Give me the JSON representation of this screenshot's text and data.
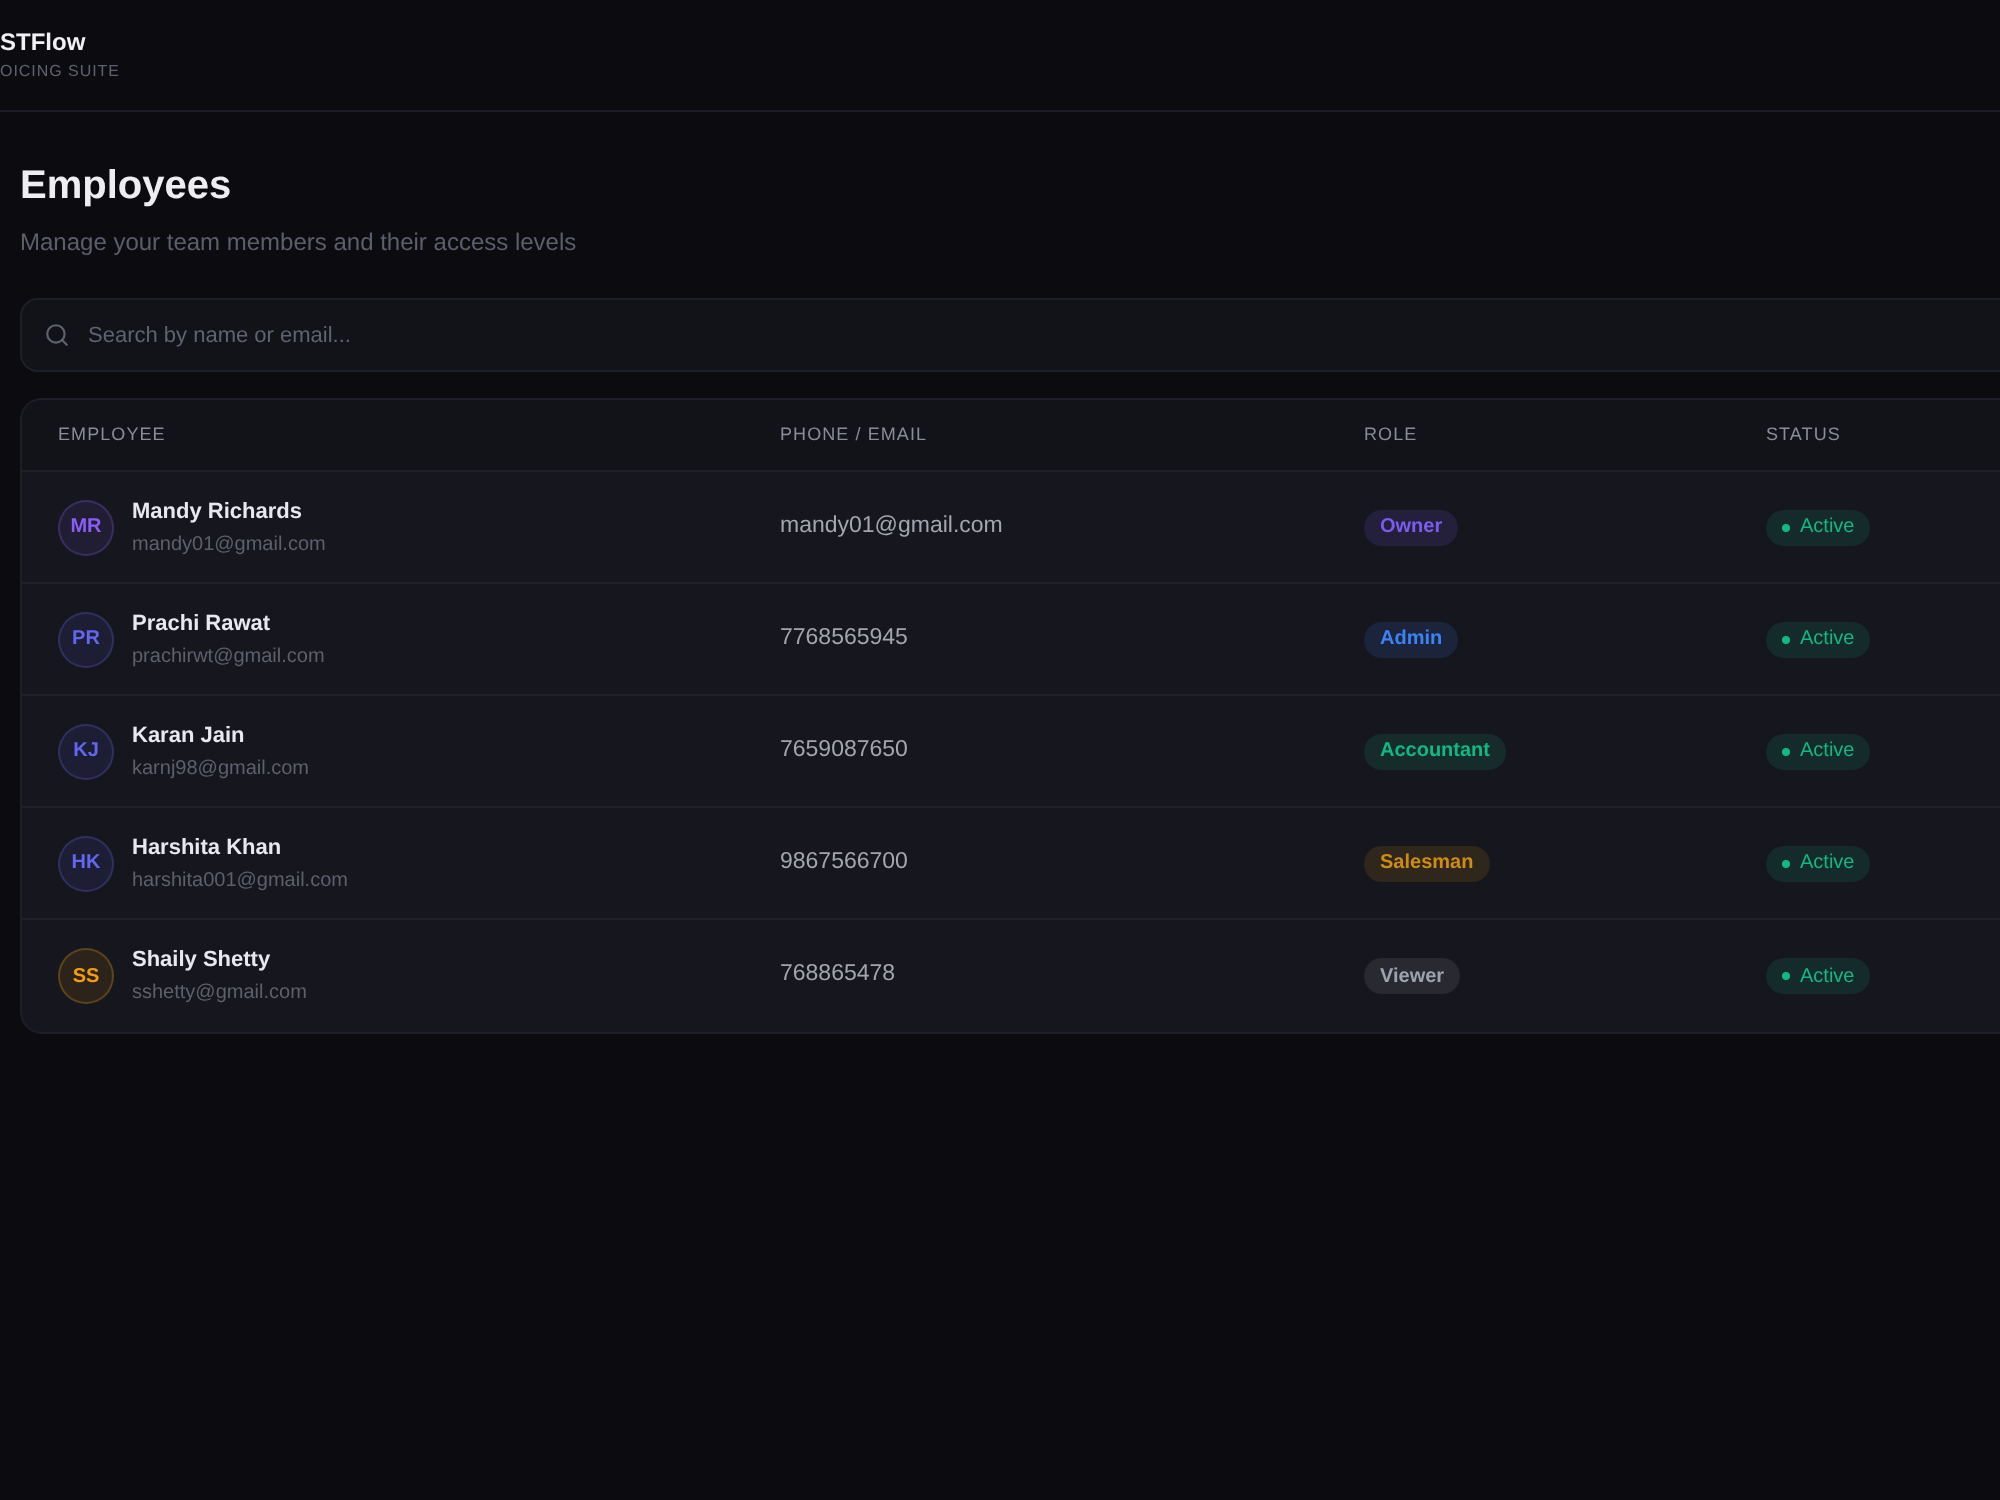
{
  "brand": {
    "name": "STFlow",
    "tagline": "OICING SUITE"
  },
  "page": {
    "title": "Employees",
    "subtitle": "Manage your team members and their access levels"
  },
  "search": {
    "placeholder": "Search by name or email..."
  },
  "table": {
    "columns": [
      "EMPLOYEE",
      "PHONE / EMAIL",
      "ROLE",
      "STATUS"
    ],
    "rows": [
      {
        "avatar": {
          "initials": "MR",
          "color": "#8b5cf6"
        },
        "name": "Mandy Richards",
        "email": "mandy01@gmail.com",
        "contact": "mandy01@gmail.com",
        "role": {
          "label": "Owner",
          "color": "#7c5cf0"
        },
        "status": {
          "label": "Active",
          "color": "#10b981"
        }
      },
      {
        "avatar": {
          "initials": "PR",
          "color": "#6366f1"
        },
        "name": "Prachi Rawat",
        "email": "prachirwt@gmail.com",
        "contact": "7768565945",
        "role": {
          "label": "Admin",
          "color": "#3b82f6"
        },
        "status": {
          "label": "Active",
          "color": "#10b981"
        }
      },
      {
        "avatar": {
          "initials": "KJ",
          "color": "#6366f1"
        },
        "name": "Karan Jain",
        "email": "karnj98@gmail.com",
        "contact": "7659087650",
        "role": {
          "label": "Accountant",
          "color": "#10b981"
        },
        "status": {
          "label": "Active",
          "color": "#10b981"
        }
      },
      {
        "avatar": {
          "initials": "HK",
          "color": "#6366f1"
        },
        "name": "Harshita Khan",
        "email": "harshita001@gmail.com",
        "contact": "9867566700",
        "role": {
          "label": "Salesman",
          "color": "#d08c10"
        },
        "status": {
          "label": "Active",
          "color": "#10b981"
        }
      },
      {
        "avatar": {
          "initials": "SS",
          "color": "#f59e0b"
        },
        "name": "Shaily Shetty",
        "email": "sshetty@gmail.com",
        "contact": "768865478",
        "role": {
          "label": "Viewer",
          "color": "#9ca3af"
        },
        "status": {
          "label": "Active",
          "color": "#10b981"
        }
      }
    ]
  }
}
